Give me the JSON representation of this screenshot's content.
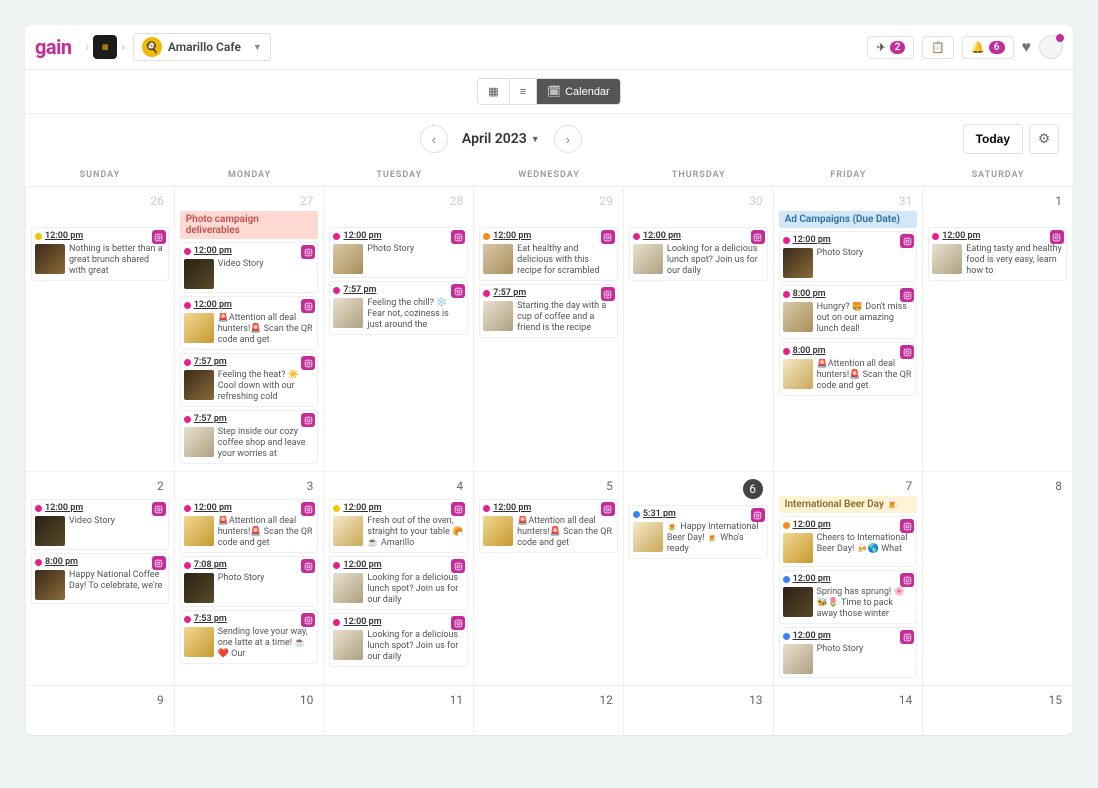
{
  "brand": "gain",
  "workspace": {
    "name": "Amarillo Cafe"
  },
  "header": {
    "send_count": "2",
    "bell_count": "6"
  },
  "viewbar": {
    "calendar_label": "Calendar"
  },
  "month": {
    "label": "April 2023",
    "today": "Today"
  },
  "dayhead": [
    "SUNDAY",
    "MONDAY",
    "TUESDAY",
    "WEDNESDAY",
    "THURSDAY",
    "FRIDAY",
    "SATURDAY"
  ],
  "banners": {
    "photo": "Photo campaign deliverables",
    "ads": "Ad Campaigns (Due Date)",
    "beer": "International Beer Day 🍺"
  },
  "week1": {
    "sun": {
      "num": "26",
      "p1": {
        "time": "12:00 pm",
        "text": "Nothing is better than a great brunch shared with great"
      }
    },
    "mon": {
      "num": "27",
      "p1": {
        "time": "12:00 pm",
        "text": "Video Story"
      },
      "p2": {
        "time": "12:00 pm",
        "text": "🚨Attention all deal hunters!🚨 Scan the QR code and get"
      },
      "p3": {
        "time": "7:57 pm",
        "text": "Feeling the heat? ☀️ Cool down with our refreshing cold"
      },
      "p4": {
        "time": "7:57 pm",
        "text": "Step inside our cozy coffee shop and leave your worries at"
      }
    },
    "tue": {
      "num": "28",
      "p1": {
        "time": "12:00 pm",
        "text": "Photo Story"
      },
      "p2": {
        "time": "7:57 pm",
        "text": "Feeling the chill? ❄️ Fear not, coziness is just around the"
      }
    },
    "wed": {
      "num": "29",
      "p1": {
        "time": "12:00 pm",
        "text": "Eat healthy and delicious with this recipe for scrambled"
      },
      "p2": {
        "time": "7:57 pm",
        "text": "Starting the day with a cup of coffee and a friend is the recipe"
      }
    },
    "thu": {
      "num": "30",
      "p1": {
        "time": "12:00 pm",
        "text": "Looking for a delicious lunch spot? Join us for our daily"
      }
    },
    "fri": {
      "num": "31",
      "p1": {
        "time": "12:00 pm",
        "text": "Photo Story"
      },
      "p2": {
        "time": "8:00 pm",
        "text": "Hungry? 🍔 Don't miss out on our amazing lunch deal!"
      },
      "p3": {
        "time": "8:00 pm",
        "text": "🚨Attention all deal hunters!🚨 Scan the QR code and get"
      }
    },
    "sat": {
      "num": "1",
      "p1": {
        "time": "12:00 pm",
        "text": "Eating tasty and healthy food is very easy, learn how to"
      }
    }
  },
  "week2": {
    "sun": {
      "num": "2",
      "p1": {
        "time": "12:00 pm",
        "text": "Video Story"
      },
      "p2": {
        "time": "8:00 pm",
        "text": "Happy National Coffee Day! To celebrate, we're"
      }
    },
    "mon": {
      "num": "3",
      "p1": {
        "time": "12:00 pm",
        "text": "🚨Attention all deal hunters!🚨 Scan the QR code and get"
      },
      "p2": {
        "time": "7:08 pm",
        "text": "Photo Story"
      },
      "p3": {
        "time": "7:53 pm",
        "text": "Sending love your way, one latte at a time! ☕❤️ Our"
      }
    },
    "tue": {
      "num": "4",
      "p1": {
        "time": "12:00 pm",
        "text": "Fresh out of the oven, straight to your table 🥐☕ Amarillo"
      },
      "p2": {
        "time": "12:00 pm",
        "text": "Looking for a delicious lunch spot? Join us for our daily"
      },
      "p3": {
        "time": "12:00 pm",
        "text": "Looking for a delicious lunch spot? Join us for our daily"
      }
    },
    "wed": {
      "num": "5",
      "p1": {
        "time": "12:00 pm",
        "text": "🚨Attention all deal hunters!🚨 Scan the QR code and get"
      }
    },
    "thu": {
      "num": "6",
      "p1": {
        "time": "5:31 pm",
        "text": "🍺 Happy International Beer Day! 🍺 Who's ready"
      }
    },
    "fri": {
      "num": "7",
      "p1": {
        "time": "12:00 pm",
        "text": "Cheers to International Beer Day! 🍻🌎 What"
      },
      "p2": {
        "time": "12:00 pm",
        "text": "Spring has sprung! 🌸🐝🌷 Time to pack away those winter"
      },
      "p3": {
        "time": "12:00 pm",
        "text": "Photo Story"
      }
    },
    "sat": {
      "num": "8"
    }
  },
  "week3": {
    "sun": "9",
    "mon": "10",
    "tue": "11",
    "wed": "12",
    "thu": "13",
    "fri": "14",
    "sat": "15"
  }
}
